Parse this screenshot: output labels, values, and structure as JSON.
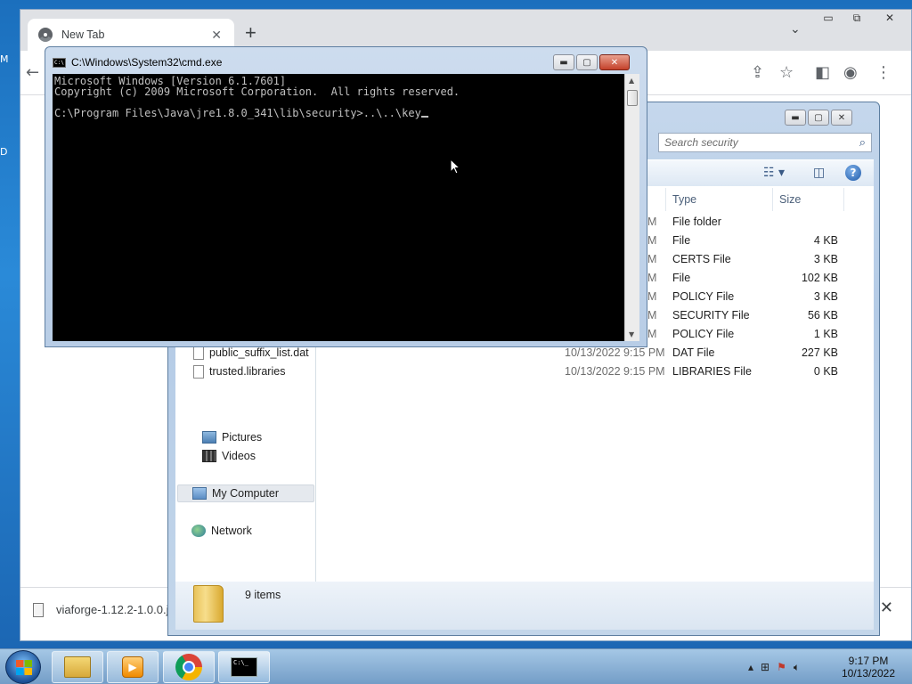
{
  "chrome": {
    "tab_title": "New Tab",
    "tab_close": "✕",
    "new_tab": "+",
    "download": {
      "file_name": "viaforge-1.12.2-1.0.0.j..."
    }
  },
  "explorer": {
    "search_placeholder": "Search security",
    "columns": {
      "type": "Type",
      "size": "Size"
    },
    "nav": {
      "pictures": "Pictures",
      "videos": "Videos",
      "computer": "My Computer",
      "network": "Network"
    },
    "files": [
      {
        "name": "",
        "date_tail": "M",
        "type": "File folder",
        "size": ""
      },
      {
        "name": "",
        "date_tail": "M",
        "type": "File",
        "size": "4 KB"
      },
      {
        "name": "",
        "date_tail": "M",
        "type": "CERTS File",
        "size": "3 KB"
      },
      {
        "name": "",
        "date_tail": "M",
        "type": "File",
        "size": "102 KB"
      },
      {
        "name": "",
        "date_tail": "M",
        "type": "POLICY File",
        "size": "3 KB"
      },
      {
        "name": "",
        "date_tail": "M",
        "type": "SECURITY File",
        "size": "56 KB"
      },
      {
        "name": "",
        "date_tail": "M",
        "type": "POLICY File",
        "size": "1 KB"
      },
      {
        "name": "public_suffix_list.dat",
        "date": "10/13/2022 9:15 PM",
        "type": "DAT File",
        "size": "227 KB"
      },
      {
        "name": "trusted.libraries",
        "date": "10/13/2022 9:15 PM",
        "type": "LIBRARIES File",
        "size": "0 KB"
      }
    ],
    "item_count": "9 items"
  },
  "cmd": {
    "title": "C:\\Windows\\System32\\cmd.exe",
    "lines": [
      "Microsoft Windows [Version 6.1.7601]",
      "Copyright (c) 2009 Microsoft Corporation.  All rights reserved.",
      "",
      "C:\\Program Files\\Java\\jre1.8.0_341\\lib\\security>..\\..\\key"
    ]
  },
  "taskbar": {
    "time": "9:17 PM",
    "date": "10/13/2022"
  },
  "colors": {
    "console_bg": "#000000",
    "console_fg": "#c0c0c0",
    "desktop_blue": "#1f74c4"
  },
  "icons": [
    "chrome-favicon",
    "search-icon",
    "help-icon",
    "folder-icon",
    "start-orb",
    "chrome-icon",
    "cmd-icon",
    "media-player-icon",
    "explorer-icon"
  ]
}
